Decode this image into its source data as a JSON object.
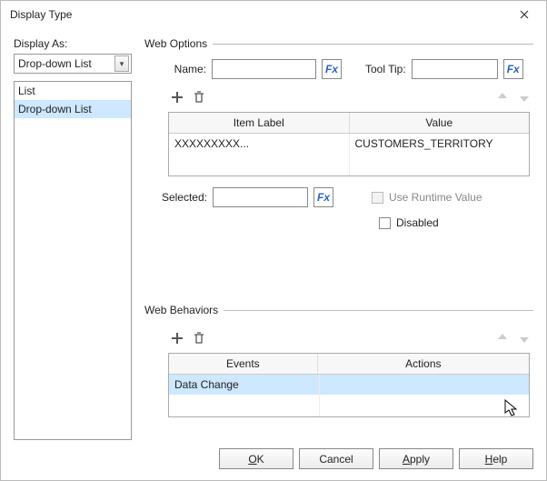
{
  "title": "Display Type",
  "left": {
    "label": "Display As:",
    "selected": "Drop-down List",
    "items": [
      "List",
      "Drop-down List"
    ],
    "highlight_index": 1
  },
  "web_options": {
    "header": "Web Options",
    "name_label": "Name:",
    "name_value": "",
    "tooltip_label": "Tool Tip:",
    "tooltip_value": "",
    "fx": "Fx",
    "grid_headers": [
      "Item Label",
      "Value"
    ],
    "grid_rows": [
      {
        "label": "XXXXXXXXX...",
        "value": "CUSTOMERS_TERRITORY"
      }
    ],
    "selected_label": "Selected:",
    "selected_value": "",
    "use_runtime_label": "Use Runtime Value",
    "disabled_label": "Disabled"
  },
  "web_behaviors": {
    "header": "Web Behaviors",
    "grid_headers": [
      "Events",
      "Actions"
    ],
    "grid_rows": [
      {
        "event": "Data Change",
        "action": ""
      }
    ]
  },
  "buttons": {
    "ok": "OK",
    "cancel": "Cancel",
    "apply": "Apply",
    "help": "Help"
  }
}
